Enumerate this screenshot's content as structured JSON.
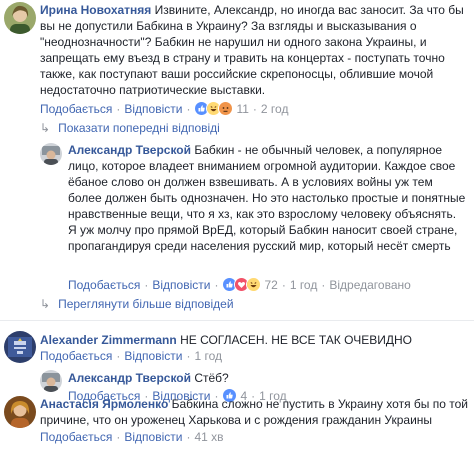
{
  "labels": {
    "like": "Подобається",
    "reply": "Відповісти",
    "dot": "·",
    "edited": "Відредаговано"
  },
  "comments": [
    {
      "author": "Ирина Новохатняя",
      "text": "Извините, Александр, но иногда вас заносит. За что бы вы не допустили Бабкина в Украину? За взгляды и высказывания о \"неоднозначности\"? Бабкин не нарушил ни одного закона Украины, и запрещать ему въезд в страну и травить на концертах - поступать точно также, как поступают ваши российские скрепоносцы, облившие мочой недостаточно патриотические выставки.",
      "reactions_count": "11",
      "time": "2 год"
    },
    {
      "author": "Александр Тверской",
      "text": "Бабкин - не обычный человек, а популярное лицо, которое владеет вниманием огромной аудитории. Каждое свое ёбаное слово он должен взвешивать. А в условиях войны уж тем более должен быть однозначен. Но это настолько простые и понятные нравственные вещи, что я хз, как это взрослому человеку объяснять. Я уж молчу про прямой ВрЕД, который Бабкин наносит своей стране, пропагандируя среди населения русский мир, который несёт смерть",
      "reactions_count": "72",
      "time": "1 год"
    },
    {
      "author": "Alexander Zimmermann",
      "text": "НЕ СОГЛАСЕН. НЕ ВСЕ ТАК ОЧЕВИДНО",
      "time": "1 год"
    },
    {
      "author": "Александр Тверской",
      "text": "Стёб?",
      "reactions_count": "4",
      "time": "1 год"
    },
    {
      "author": "Анастасія Ярмоленко",
      "text": "Бабкина сложно не пустить в Украину хотя бы по той причине, что он уроженец Харькова и с рождения гражданин Украины",
      "time": "41 хв"
    }
  ],
  "view_previous": "Показати попередні відповіді",
  "view_more": "Переглянути більше відповідей",
  "colors": {
    "link": "#365899",
    "action": "#4267b2",
    "muted": "#90949c",
    "like_blue": "#5890ff",
    "love_red": "#f25268",
    "haha_yellow": "#ffd972"
  }
}
